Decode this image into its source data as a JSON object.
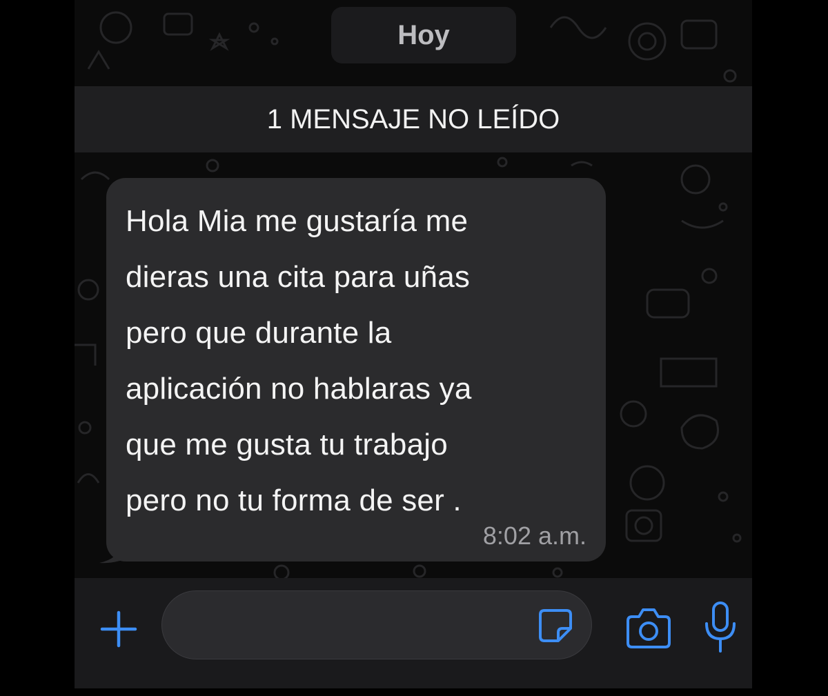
{
  "colors": {
    "accent": "#3d8ef5",
    "bubble": "#2b2b2d",
    "background": "#0b0b0b",
    "unread_bar": "#1f1f21"
  },
  "chat": {
    "date_label": "Hoy",
    "unread_label": "1 MENSAJE NO LEÍDO",
    "message": {
      "text": "Hola Mia me gustaría me\ndieras una cita para uñas\npero que durante la\naplicación no hablaras ya\nque me gusta tu trabajo\npero no tu forma de ser .",
      "time": "8:02 a.m."
    }
  },
  "input_bar": {
    "input_value": "",
    "icons": {
      "attach": "plus-icon",
      "sticker": "sticker-icon",
      "camera": "camera-icon",
      "mic": "microphone-icon"
    }
  }
}
